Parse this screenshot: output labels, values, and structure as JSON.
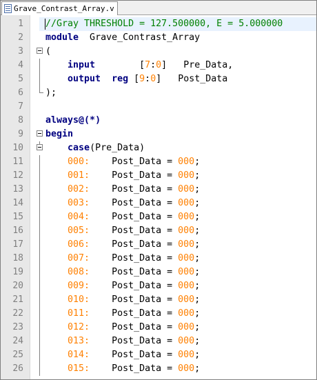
{
  "tab": {
    "label": "Grave_Contrast_Array.v"
  },
  "editor": {
    "lines": [
      {
        "num": "1"
      },
      {
        "num": "2"
      },
      {
        "num": "3"
      },
      {
        "num": "4"
      },
      {
        "num": "5"
      },
      {
        "num": "6"
      },
      {
        "num": "7"
      },
      {
        "num": "8"
      },
      {
        "num": "9"
      },
      {
        "num": "10"
      },
      {
        "num": "11"
      },
      {
        "num": "12"
      },
      {
        "num": "13"
      },
      {
        "num": "14"
      },
      {
        "num": "15"
      },
      {
        "num": "16"
      },
      {
        "num": "17"
      },
      {
        "num": "18"
      },
      {
        "num": "19"
      },
      {
        "num": "20"
      },
      {
        "num": "21"
      },
      {
        "num": "22"
      },
      {
        "num": "23"
      },
      {
        "num": "24"
      },
      {
        "num": "25"
      },
      {
        "num": "26"
      }
    ],
    "code": {
      "l1": "//Gray THRESHOLD = 127.500000, E = 5.000000",
      "l2_kw": "module",
      "l2_name": "  Grave_Contrast_Array",
      "l3": "(",
      "l4_kw": "input",
      "l4_range": "[7:0]",
      "l4_name": "Pre_Data,",
      "l5_kw1": "output",
      "l5_kw2": "reg",
      "l5_range": "[9:0]",
      "l5_name": "Post_Data",
      "l6": ");",
      "l8_kw": "always",
      "l8_rest": "@(*)",
      "l9_kw": "begin",
      "l10_kw": "case",
      "l10_rest": "(Pre_Data)",
      "case_rows": [
        {
          "label": "000:",
          "target": "Post_Data = ",
          "value": "000",
          "end": ";"
        },
        {
          "label": "001:",
          "target": "Post_Data = ",
          "value": "000",
          "end": ";"
        },
        {
          "label": "002:",
          "target": "Post_Data = ",
          "value": "000",
          "end": ";"
        },
        {
          "label": "003:",
          "target": "Post_Data = ",
          "value": "000",
          "end": ";"
        },
        {
          "label": "004:",
          "target": "Post_Data = ",
          "value": "000",
          "end": ";"
        },
        {
          "label": "005:",
          "target": "Post_Data = ",
          "value": "000",
          "end": ";"
        },
        {
          "label": "006:",
          "target": "Post_Data = ",
          "value": "000",
          "end": ";"
        },
        {
          "label": "007:",
          "target": "Post_Data = ",
          "value": "000",
          "end": ";"
        },
        {
          "label": "008:",
          "target": "Post_Data = ",
          "value": "000",
          "end": ";"
        },
        {
          "label": "009:",
          "target": "Post_Data = ",
          "value": "000",
          "end": ";"
        },
        {
          "label": "010:",
          "target": "Post_Data = ",
          "value": "000",
          "end": ";"
        },
        {
          "label": "011:",
          "target": "Post_Data = ",
          "value": "000",
          "end": ";"
        },
        {
          "label": "012:",
          "target": "Post_Data = ",
          "value": "000",
          "end": ";"
        },
        {
          "label": "013:",
          "target": "Post_Data = ",
          "value": "000",
          "end": ";"
        },
        {
          "label": "014:",
          "target": "Post_Data = ",
          "value": "000",
          "end": ";"
        },
        {
          "label": "015:",
          "target": "Post_Data = ",
          "value": "000",
          "end": ";"
        }
      ]
    }
  },
  "colors": {
    "keyword": "#000080",
    "number": "#ff8000",
    "comment": "#008000",
    "current_line": "#e8f2fe",
    "gutter": "#e8e8e8"
  }
}
